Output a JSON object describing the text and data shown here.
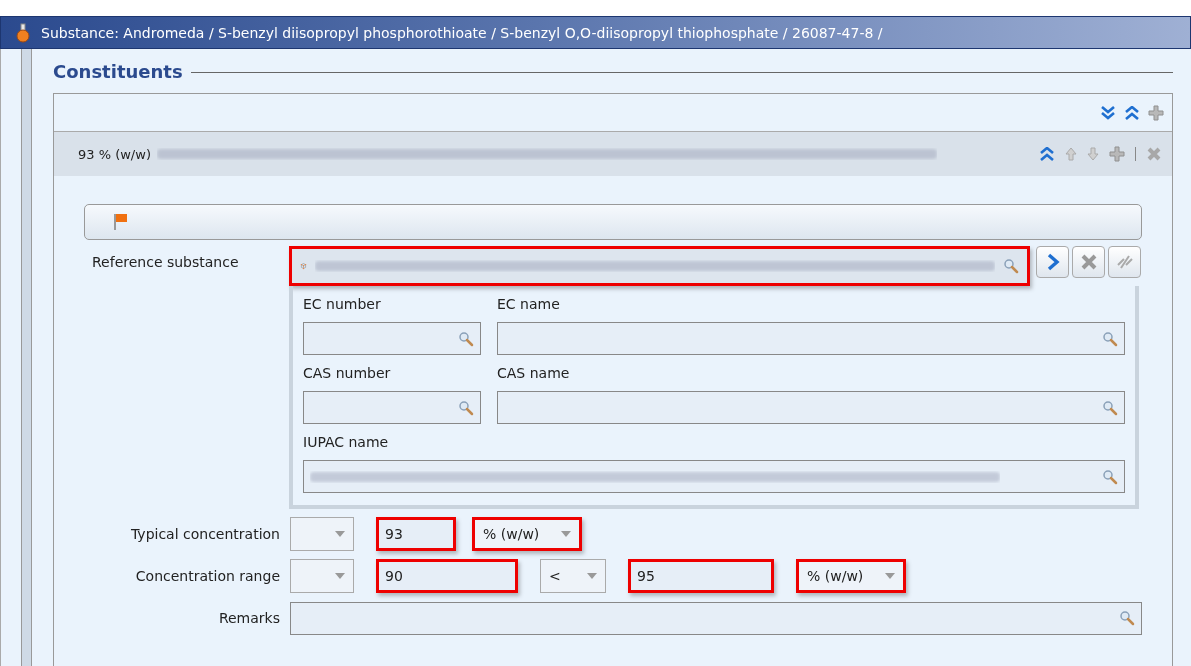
{
  "window": {
    "title": "Substance: Andromeda / S-benzyl diisopropyl phosphorothioate / S-benzyl O,O-diisopropyl thiophosphate / 26087-47-8 /"
  },
  "section": {
    "title": "Constituents"
  },
  "entry": {
    "title": "93 % (w/w)",
    "expanded": true,
    "obscured": true
  },
  "reference_substance": {
    "label": "Reference substance",
    "highlighted": true,
    "obscured": true,
    "details": [
      {
        "label": "EC number",
        "kind": "short"
      },
      {
        "label": "EC name",
        "kind": "long"
      },
      {
        "label": "CAS number",
        "kind": "short"
      },
      {
        "label": "CAS name",
        "kind": "long"
      },
      {
        "label": "IUPAC name",
        "kind": "full",
        "obscured": true
      }
    ]
  },
  "concentrations": [
    {
      "label": "Typical concentration",
      "controls": [
        {
          "kind": "select",
          "highlighted": false
        },
        {
          "kind": "input",
          "value": "93",
          "highlighted": true
        },
        {
          "kind": "select",
          "value": "% (w/w)",
          "highlighted": true
        }
      ]
    },
    {
      "label": "Concentration range",
      "controls": [
        {
          "kind": "select",
          "highlighted": false
        },
        {
          "kind": "input",
          "value": "90",
          "highlighted": true
        },
        {
          "kind": "select",
          "value": "<",
          "highlighted": false
        },
        {
          "kind": "input",
          "value": "95",
          "highlighted": true
        },
        {
          "kind": "select",
          "value": "% (w/w)",
          "highlighted": true
        }
      ]
    }
  ],
  "remarks": {
    "label": "Remarks"
  }
}
